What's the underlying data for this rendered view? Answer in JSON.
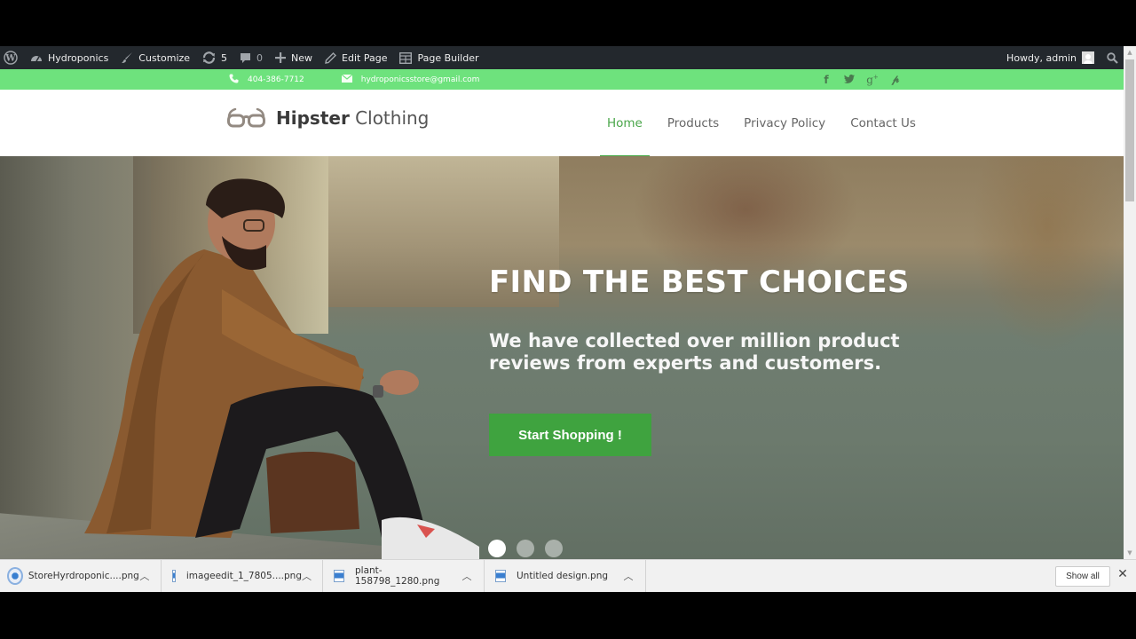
{
  "admin_bar": {
    "items": [
      {
        "label": "",
        "icon": "wordpress-icon"
      },
      {
        "label": "Hydroponics",
        "icon": "dashboard-icon"
      },
      {
        "label": "Customize",
        "icon": "brush-icon"
      },
      {
        "label": "5",
        "icon": "updates-icon"
      },
      {
        "label": "0",
        "icon": "comment-icon"
      },
      {
        "label": "New",
        "icon": "plus-icon"
      },
      {
        "label": "Edit Page",
        "icon": "pencil-icon"
      },
      {
        "label": "Page Builder",
        "icon": "page-builder-icon"
      }
    ],
    "greeting": "Howdy, admin"
  },
  "topbar": {
    "phone": "404-386-7712",
    "email": "hydroponicsstore@gmail.com",
    "social": [
      "f",
      "t",
      "g+",
      "p"
    ],
    "color": "#6ee27d"
  },
  "header": {
    "logo_bold": "Hipster",
    "logo_light": "Clothing",
    "nav": [
      {
        "label": "Home",
        "active": true
      },
      {
        "label": "Products",
        "active": false
      },
      {
        "label": "Privacy Policy",
        "active": false
      },
      {
        "label": "Contact Us",
        "active": false
      }
    ],
    "accent": "#3ea53e"
  },
  "hero": {
    "title": "FIND THE BEST CHOICES",
    "subtitle_line1": "We have collected over million product",
    "subtitle_line2": "reviews from experts and customers.",
    "cta": "Start Shopping !",
    "slides": 3,
    "active_slide": 1
  },
  "downloads": {
    "items": [
      {
        "name": "StoreHyrdroponic....png"
      },
      {
        "name": "imageedit_1_7805....png"
      },
      {
        "name": "plant-158798_1280.png"
      },
      {
        "name": "Untitled design.png"
      }
    ],
    "show_all": "Show all",
    "close": "✕"
  }
}
